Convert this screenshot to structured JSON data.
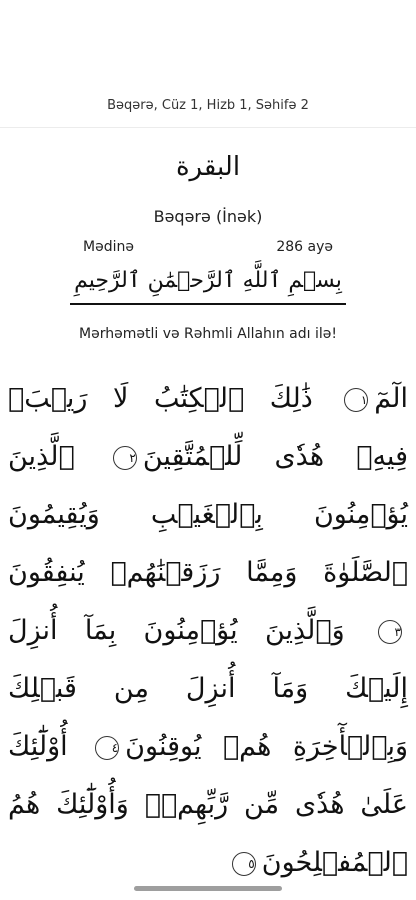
{
  "header": {
    "title": "Bəqərə, Cüz 1, Hizb 1, Səhifə 2"
  },
  "surah": {
    "arabic_name": "البقرة",
    "name": "Bəqərə (İnək)",
    "place": "Mədinə",
    "ayah_count": "286 ayə"
  },
  "basmala": {
    "arabic": "بِسۡمِ ٱللَّهِ ٱلرَّحۡمَٰنِ ٱلرَّحِيمِ",
    "translation": "Mərhəmətli və Rəhmli Allahın adı ilə!"
  },
  "verses": [
    {
      "text": "الٓمٓ",
      "number": "١"
    },
    {
      "text": "ذَٰلِكَ ٱلۡكِتَٰبُ لَا رَيۡبَۛ فِيهِۛ هُدٗى لِّلۡمُتَّقِينَ",
      "number": "٢"
    },
    {
      "text": "ٱلَّذِينَ يُؤۡمِنُونَ بِٱلۡغَيۡبِ وَيُقِيمُونَ ٱلصَّلَوٰةَ وَمِمَّا رَزَقۡنَٰهُمۡ يُنفِقُونَ",
      "number": "٣"
    },
    {
      "text": "وَٱلَّذِينَ يُؤۡمِنُونَ بِمَآ أُنزِلَ إِلَيۡكَ وَمَآ أُنزِلَ مِن قَبۡلِكَ وَبِٱلۡأٓخِرَةِ هُمۡ يُوقِنُونَ",
      "number": "٤"
    },
    {
      "text": "أُوْلَٰٓئِكَ عَلَىٰ هُدٗى مِّن رَّبِّهِمۡۖ وَأُوْلَٰٓئِكَ هُمُ ٱلۡمُفۡلِحُونَ",
      "number": "٥"
    }
  ]
}
